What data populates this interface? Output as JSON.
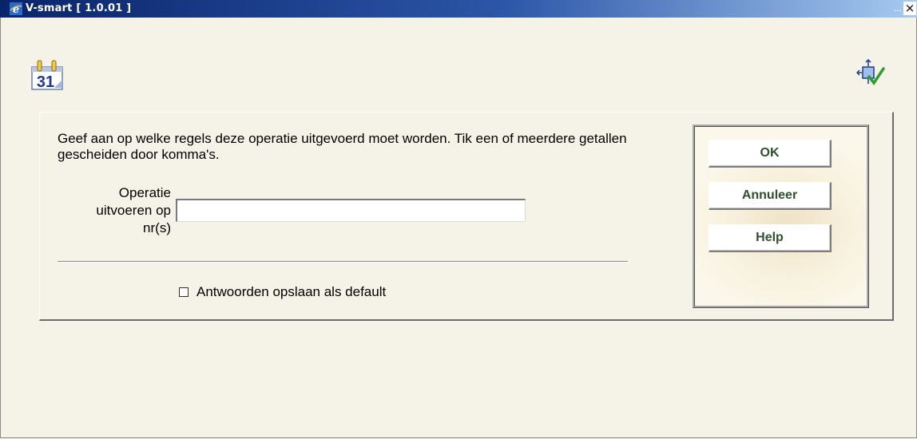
{
  "window": {
    "title": "V-smart [ 1.0.01 ]",
    "minimize_glyph": "...",
    "close_glyph": "×"
  },
  "toolbar": {
    "calendar_icon": "calendar-icon",
    "calendar_day": "31",
    "selection_icon": "select-rows-check-icon"
  },
  "form": {
    "instructions": "Geef aan op welke regels deze operatie uitgevoerd moet worden. Tik een of meerdere getallen gescheiden door komma's.",
    "field_label_line1": "Operatie",
    "field_label_line2": "uitvoeren op",
    "field_label_line3": "nr(s)",
    "field_value": "",
    "save_default_label": "Antwoorden opslaan als default",
    "save_default_checked": false
  },
  "buttons": {
    "ok": "OK",
    "cancel": "Annuleer",
    "help": "Help"
  },
  "colors": {
    "titlebar_start": "#0a246a",
    "titlebar_end": "#a6caf0",
    "background": "#f5f3e7",
    "button_text": "#2f4f2f",
    "checkmark": "#2e9e2e"
  }
}
